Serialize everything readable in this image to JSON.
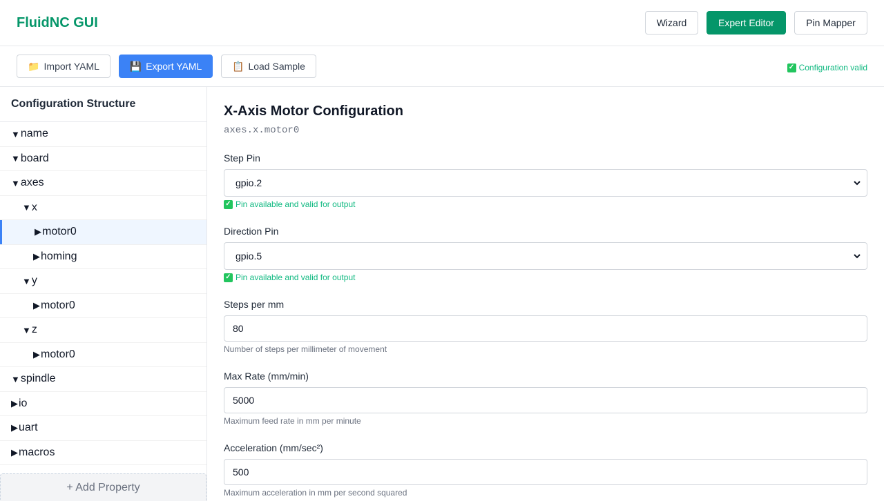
{
  "header": {
    "brand": "FluidNC GUI",
    "nav": {
      "wizard": "Wizard",
      "expert": "Expert Editor",
      "pin_mapper": "Pin Mapper"
    }
  },
  "toolbar": {
    "import_label": "Import YAML",
    "export_label": "Export YAML",
    "load_label": "Load Sample",
    "status": "Configuration valid"
  },
  "sidebar": {
    "title": "Configuration Structure",
    "items": [
      {
        "label": "name",
        "arrow": "▼"
      },
      {
        "label": "board",
        "arrow": "▼"
      },
      {
        "label": "axes",
        "arrow": "▼"
      },
      {
        "label": "x",
        "arrow": "▼"
      },
      {
        "label": "motor0",
        "arrow": "▶"
      },
      {
        "label": "homing",
        "arrow": "▶"
      },
      {
        "label": "y",
        "arrow": "▼"
      },
      {
        "label": "motor0",
        "arrow": "▶"
      },
      {
        "label": "z",
        "arrow": "▼"
      },
      {
        "label": "motor0",
        "arrow": "▶"
      },
      {
        "label": "spindle",
        "arrow": "▼"
      },
      {
        "label": "io",
        "arrow": "▶"
      },
      {
        "label": "uart",
        "arrow": "▶"
      },
      {
        "label": "macros",
        "arrow": "▶"
      }
    ],
    "add_label": "+ Add Property"
  },
  "main": {
    "title": "X-Axis Motor Configuration",
    "path": "axes.x.motor0",
    "step_pin": {
      "label": "Step Pin",
      "value": "gpio.2",
      "status": "Pin available and valid for output"
    },
    "dir_pin": {
      "label": "Direction Pin",
      "value": "gpio.5",
      "status": "Pin available and valid for output"
    },
    "steps": {
      "label": "Steps per mm",
      "value": "80",
      "hint": "Number of steps per millimeter of movement"
    },
    "max_rate": {
      "label": "Max Rate (mm/min)",
      "value": "5000",
      "hint": "Maximum feed rate in mm per minute"
    },
    "accel": {
      "label": "Acceleration (mm/sec²)",
      "value": "500",
      "hint": "Maximum acceleration in mm per second squared"
    }
  },
  "colors": {
    "brand": "#059669",
    "primary": "#3b82f6",
    "success": "#10b981"
  }
}
